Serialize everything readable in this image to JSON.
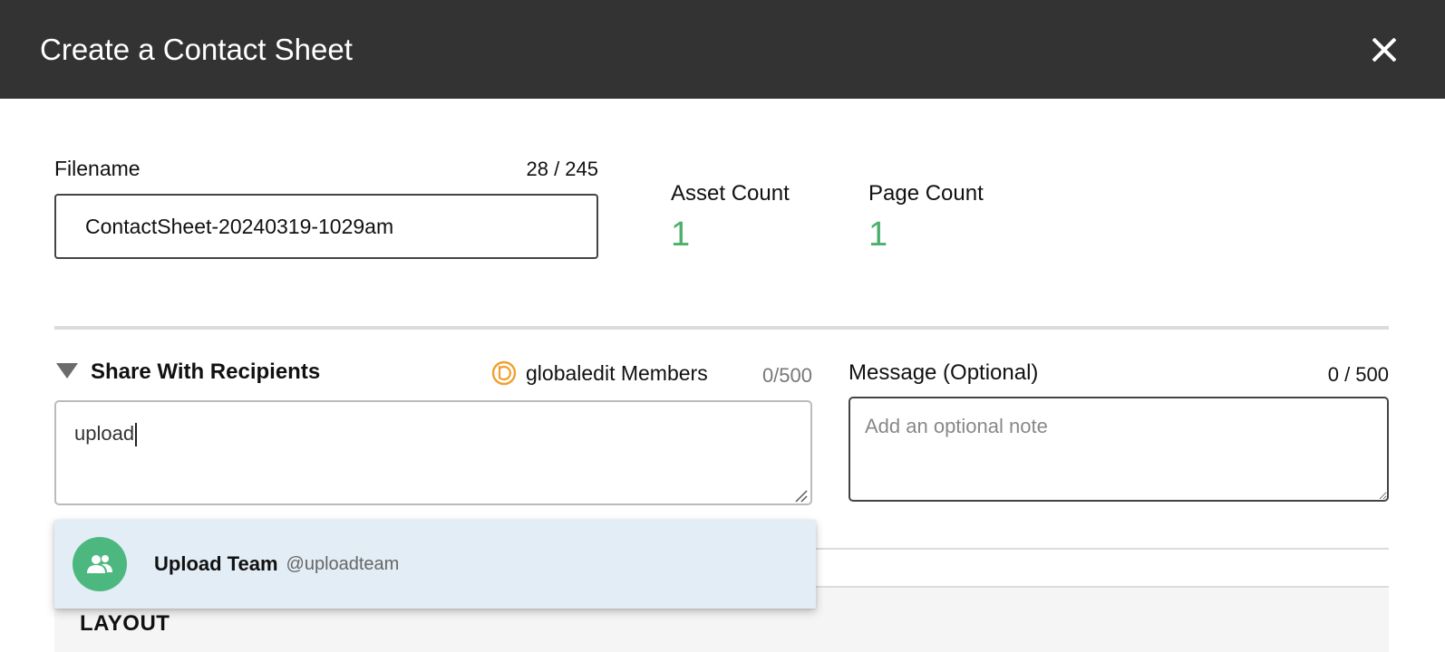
{
  "header": {
    "title": "Create a Contact Sheet"
  },
  "filename": {
    "label": "Filename",
    "count": "28 / 245",
    "value": "ContactSheet-20240319-1029am"
  },
  "stats": {
    "asset_label": "Asset Count",
    "asset_value": "1",
    "page_label": "Page Count",
    "page_value": "1"
  },
  "share": {
    "title": "Share With Recipients",
    "members_label": "globaledit Members",
    "recipient_count": "0/500",
    "input_value": "upload"
  },
  "message": {
    "label": "Message (Optional)",
    "count": "0 / 500",
    "placeholder": "Add an optional note"
  },
  "suggestion": {
    "name": "Upload Team",
    "handle": "@uploadteam",
    "icon": "group-icon"
  },
  "layout": {
    "title": "LAYOUT"
  },
  "colors": {
    "header_bg": "#333333",
    "accent_green": "#4caf6a",
    "brand_orange": "#f0a030",
    "suggestion_bg": "#e3edf5"
  }
}
